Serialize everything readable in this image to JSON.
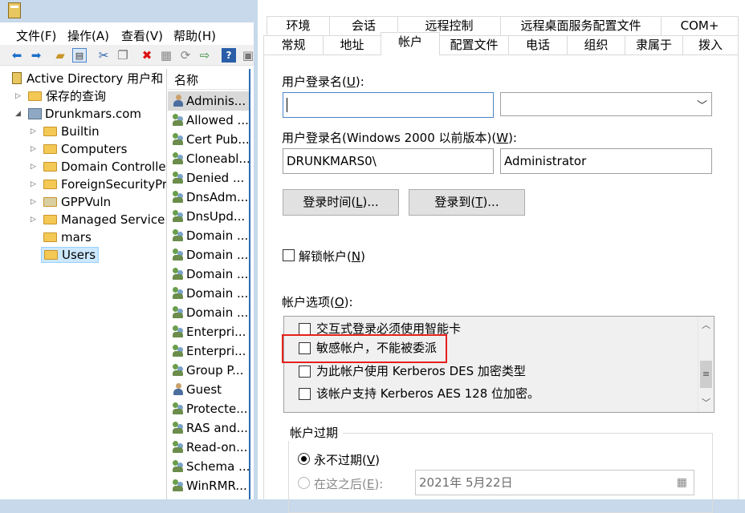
{
  "mmc": {
    "menu": [
      "文件(F)",
      "操作(A)",
      "查看(V)",
      "帮助(H)"
    ],
    "tree": {
      "root": "Active Directory 用户和",
      "saved_queries": "保存的查询",
      "domain": "Drunkmars.com",
      "children": [
        "Builtin",
        "Computers",
        "Domain Controller",
        "ForeignSecurityPr",
        "GPPVuln",
        "Managed Service",
        "mars",
        "Users"
      ]
    },
    "list": {
      "column_header": "名称",
      "rows": [
        "Adminis...",
        "Allowed ...",
        "Cert Pub...",
        "Cloneabl...",
        "Denied ...",
        "DnsAdm...",
        "DnsUpd...",
        "Domain ...",
        "Domain ...",
        "Domain ...",
        "Domain ...",
        "Domain ...",
        "Enterpri...",
        "Enterpri...",
        "Group P...",
        "Guest",
        "Protecte...",
        "RAS and...",
        "Read-on...",
        "Schema ...",
        "WinRMR..."
      ]
    }
  },
  "dialog": {
    "tabs_row1": [
      "环境",
      "会话",
      "远程控制",
      "远程桌面服务配置文件",
      "COM+"
    ],
    "tabs_row2": [
      "常规",
      "地址",
      "帐户",
      "配置文件",
      "电话",
      "组织",
      "隶属于",
      "拨入"
    ],
    "logon_name_label": "用户登录名(",
    "logon_name_key": "U",
    "logon_name_value": "",
    "pre2000_label": "用户登录名(Windows 2000 以前版本)(",
    "pre2000_key": "W",
    "pre2000_domain": "DRUNKMARS0\\",
    "pre2000_user": "Administrator",
    "logon_hours_btn": "登录时间(",
    "logon_hours_key": "L",
    "logon_to_btn": "登录到(",
    "logon_to_key": "T",
    "unlock_label": "解锁帐户(",
    "unlock_key": "N",
    "options_label": "帐户选项(",
    "options_key": "O",
    "options": [
      "交互式登录必须使用智能卡",
      "敏感帐户，不能被委派",
      "为此帐户使用 Kerberos DES 加密类型",
      "该帐户支持 Kerberos AES 128 位加密。"
    ],
    "expires_title": "帐户过期",
    "never_expires": "永不过期(",
    "never_expires_key": "V",
    "end_of": "在这之后(",
    "end_of_key": "E",
    "date_value": "2021年  5月22日"
  },
  "colors": {
    "highlight": "#e6201a",
    "titlebar": "#c7d9ea",
    "accent": "#2b6cb0"
  }
}
